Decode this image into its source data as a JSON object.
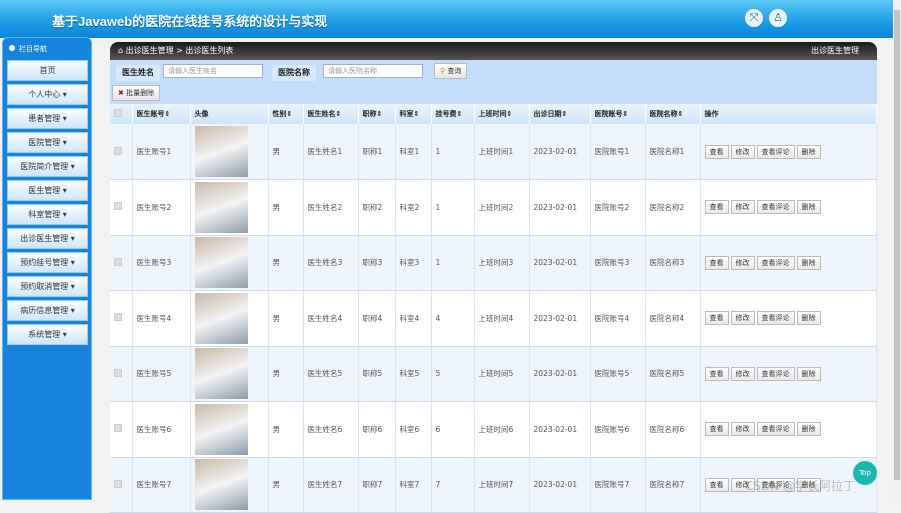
{
  "header": {
    "title": "基于Javaweb的医院在线挂号系统的设计与实现"
  },
  "sidebar": {
    "title": "栏目导航",
    "items": [
      "首页",
      "个人中心 ▾",
      "患者管理 ▾",
      "医院管理 ▾",
      "医院简介管理 ▾",
      "医生管理 ▾",
      "科室管理 ▾",
      "出诊医生管理 ▾",
      "预约挂号管理 ▾",
      "预约取消管理 ▾",
      "病历信息管理 ▾",
      "系统管理 ▾"
    ]
  },
  "breadcrumb": {
    "path": "出诊医生管理 > 出诊医生列表",
    "right": "出诊医生管理"
  },
  "search": {
    "doctor_label": "医生姓名",
    "doctor_placeholder": "请输入医生姓名",
    "hospital_label": "医院名称",
    "hospital_placeholder": "请输入医院名称",
    "search_btn": "查询",
    "batch_delete": "批量删除"
  },
  "table": {
    "headers": [
      "医生账号⇕",
      "头像",
      "性别⇕",
      "医生姓名⇕",
      "职称⇕",
      "科室⇕",
      "挂号费⇕",
      "上班时间⇕",
      "出诊日期⇕",
      "医院账号⇕",
      "医院名称⇕",
      "操作"
    ],
    "rows": [
      [
        "医生账号1",
        "男",
        "医生姓名1",
        "职称1",
        "科室1",
        "1",
        "上班时间1",
        "2023-02-01",
        "医院账号1",
        "医院名称1"
      ],
      [
        "医生账号2",
        "男",
        "医生姓名2",
        "职称2",
        "科室2",
        "1",
        "上班时间2",
        "2023-02-01",
        "医院账号2",
        "医院名称2"
      ],
      [
        "医生账号3",
        "男",
        "医生姓名3",
        "职称3",
        "科室3",
        "1",
        "上班时间3",
        "2023-02-01",
        "医院账号3",
        "医院名称3"
      ],
      [
        "医生账号4",
        "男",
        "医生姓名4",
        "职称4",
        "科室4",
        "4",
        "上班时间4",
        "2023-02-01",
        "医院账号4",
        "医院名称4"
      ],
      [
        "医生账号5",
        "男",
        "医生姓名5",
        "职称5",
        "科室5",
        "5",
        "上班时间5",
        "2023-02-01",
        "医院账号5",
        "医院名称5"
      ],
      [
        "医生账号6",
        "男",
        "医生姓名6",
        "职称6",
        "科室6",
        "6",
        "上班时间6",
        "2023-02-01",
        "医院账号6",
        "医院名称6"
      ],
      [
        "医生账号7",
        "男",
        "医生姓名7",
        "职称7",
        "科室7",
        "7",
        "上班时间7",
        "2023-02-01",
        "医院账号7",
        "医院名称7"
      ]
    ],
    "actions": [
      "查看",
      "修改",
      "查看评论",
      "删除"
    ]
  },
  "top_button": "Top",
  "watermark": "CSDN @学长阿拉丁"
}
